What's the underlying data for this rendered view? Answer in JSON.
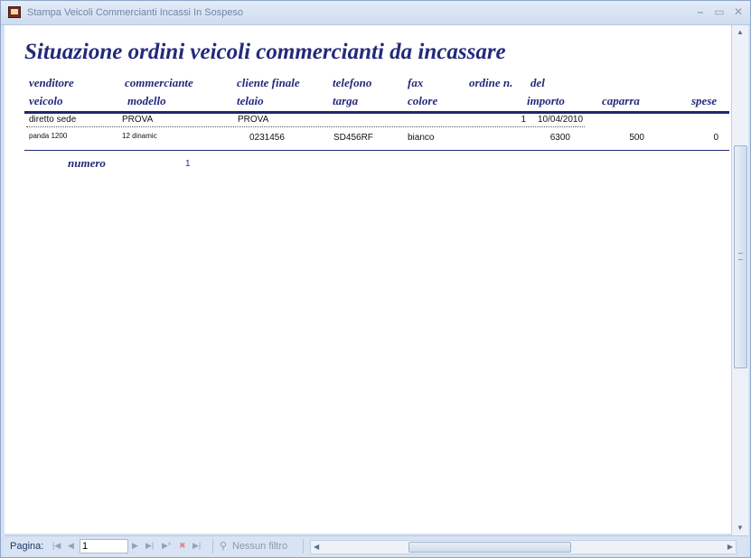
{
  "window": {
    "title": "Stampa Veicoli Commercianti Incassi In Sospeso",
    "controls": {
      "minimize": "–",
      "maximize": "▭",
      "close": "✕"
    }
  },
  "report": {
    "title": "Situazione ordini veicoli commercianti da incassare",
    "headers_row1": {
      "venditore": "venditore",
      "commerciante": "commerciante",
      "cliente_finale": "cliente finale",
      "telefono": "telefono",
      "fax": "fax",
      "ordine_n": "ordine n.",
      "del": "del"
    },
    "headers_row2": {
      "veicolo": "veicolo",
      "modello": "modello",
      "telaio": "telaio",
      "targa": "targa",
      "colore": "colore",
      "importo": "importo",
      "caparra": "caparra",
      "spese": "spese"
    },
    "record": {
      "venditore": "diretto sede",
      "commerciante": "PROVA",
      "cliente_finale": "PROVA",
      "ordine_n": "1",
      "del": "10/04/2010",
      "veicolo": "panda 1200",
      "modello": "12 dinamic",
      "telaio": "0231456",
      "targa": "SD456RF",
      "colore": "bianco",
      "importo": "6300",
      "caparra": "500",
      "spese": "0"
    },
    "footer": {
      "numero_label": "numero",
      "numero_value": "1"
    }
  },
  "statusbar": {
    "page_label": "Pagina:",
    "page_value": "1",
    "filter_label": "Nessun filtro"
  }
}
